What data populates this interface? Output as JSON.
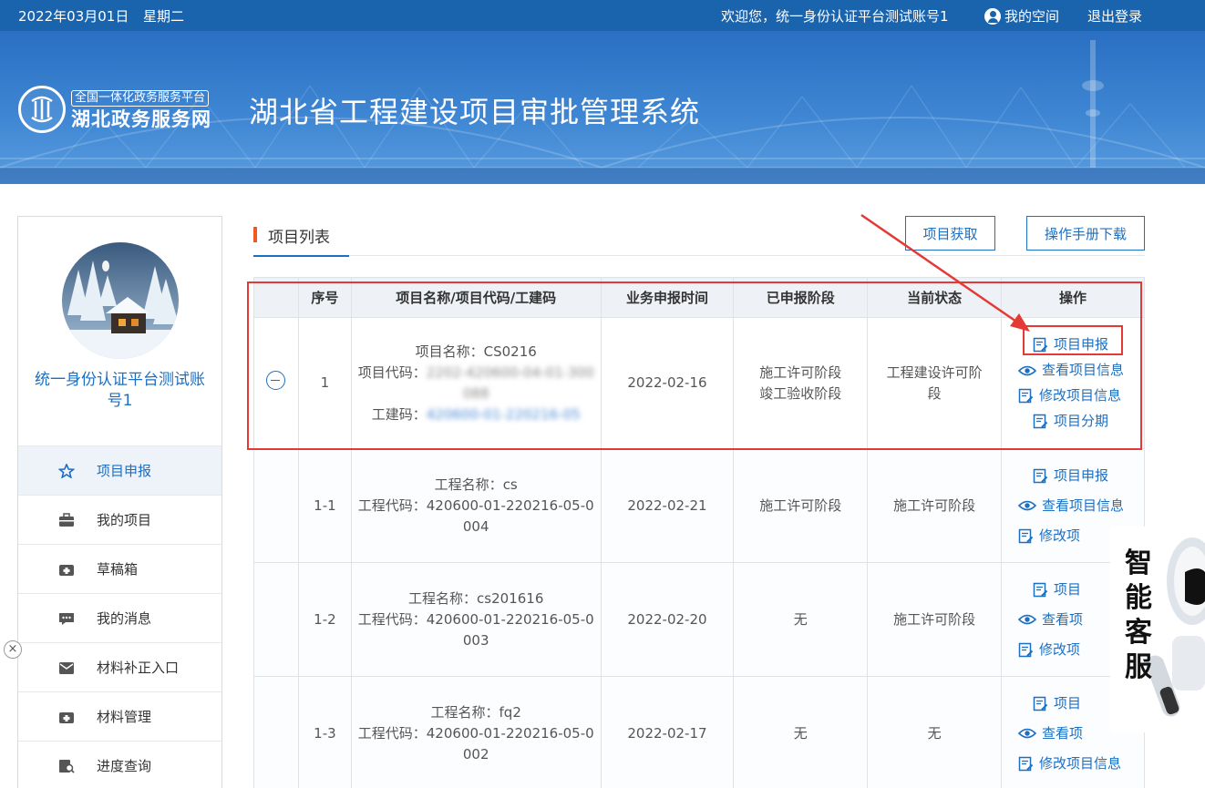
{
  "topbar": {
    "date": "2022年03月01日",
    "weekday": "星期二",
    "welcome": "欢迎您，统一身份认证平台测试账号1",
    "my_space": "我的空间",
    "logout": "退出登录"
  },
  "banner": {
    "logo_sub": "全国一体化政务服务平台",
    "logo_main": "湖北政务服务网",
    "system_title": "湖北省工程建设项目审批管理系统"
  },
  "sidebar": {
    "user_name": "统一身份认证平台测试账号1",
    "menu": [
      {
        "label": "项目申报",
        "icon": "star-icon"
      },
      {
        "label": "我的项目",
        "icon": "briefcase-icon"
      },
      {
        "label": "草稿箱",
        "icon": "draft-box-icon"
      },
      {
        "label": "我的消息",
        "icon": "message-icon"
      },
      {
        "label": "材料补正入口",
        "icon": "mail-icon"
      },
      {
        "label": "材料管理",
        "icon": "folder-icon"
      },
      {
        "label": "进度查询",
        "icon": "search-doc-icon"
      }
    ]
  },
  "content": {
    "section_title": "项目列表",
    "btn_fetch": "项目获取",
    "btn_manual": "操作手册下载"
  },
  "table": {
    "headers": [
      "",
      "序号",
      "项目名称/项目代码/工建码",
      "业务申报时间",
      "已申报阶段",
      "当前状态",
      "操作"
    ],
    "main_row": {
      "index": "1",
      "name_label": "项目名称：",
      "name_value": "CS0216",
      "code_label": "项目代码：",
      "code_value_blurred": "2202-420600-04-01-300",
      "code_value_blurred_2": "088",
      "gongjian_label": "工建码：",
      "gongjian_value_blurred": "420600-01-220216-05",
      "date": "2022-02-16",
      "stages": [
        "施工许可阶段",
        "竣工验收阶段"
      ],
      "status": "工程建设许可阶段",
      "ops": [
        "项目申报",
        "查看项目信息",
        "修改项目信息",
        "项目分期"
      ]
    },
    "child_rows": [
      {
        "index": "1-1",
        "name_label": "工程名称：",
        "name_value": "cs",
        "code_label": "工程代码：",
        "code_value": "420600-01-220216-05-0",
        "code_value_2": "004",
        "date": "2022-02-21",
        "stage": "施工许可阶段",
        "status": "施工许可阶段",
        "ops": [
          "项目申报",
          "查看项目信息",
          "修改项"
        ]
      },
      {
        "index": "1-2",
        "name_label": "工程名称：",
        "name_value": "cs201616",
        "code_label": "工程代码：",
        "code_value": "420600-01-220216-05-0",
        "code_value_2": "003",
        "date": "2022-02-20",
        "stage": "无",
        "status": "施工许可阶段",
        "ops": [
          "项目",
          "查看项",
          "修改项"
        ]
      },
      {
        "index": "1-3",
        "name_label": "工程名称：",
        "name_value": "fq2",
        "code_label": "工程代码：",
        "code_value": "420600-01-220216-05-0",
        "code_value_2": "002",
        "date": "2022-02-17",
        "stage": "无",
        "status": "无",
        "ops": [
          "项目",
          "查看项",
          "修改项目信息"
        ]
      }
    ]
  },
  "float": {
    "close": "×",
    "robot_text": "智能客服"
  },
  "colors": {
    "primary": "#1d6fc2",
    "topbar": "#1a63ad",
    "accent_orange": "#f05a22",
    "annotation_red": "#e53935"
  }
}
